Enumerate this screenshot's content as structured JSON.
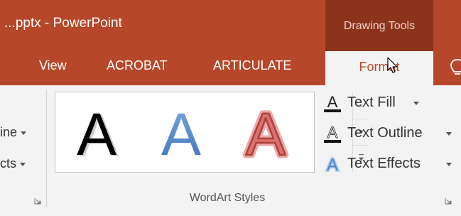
{
  "window": {
    "title": "...pptx - PowerPoint",
    "contextual_group": "Drawing Tools"
  },
  "tabs": {
    "view": "View",
    "acrobat": "ACROBAT",
    "articulate": "ARTICULATE",
    "format": "Format",
    "active": "Format"
  },
  "ribbon": {
    "left_clipped": {
      "shape_outline": "ine",
      "shape_effects": "cts"
    },
    "wordart_gallery": {
      "items": [
        {
          "glyph": "A",
          "style": "black fill with shadow",
          "fill": "#000000"
        },
        {
          "glyph": "A",
          "style": "blue gradient fill",
          "fill": "#5a8ccf"
        },
        {
          "glyph": "A",
          "style": "red outline with glow",
          "fill": "#d9716e"
        }
      ]
    },
    "commands": {
      "text_fill": "Text Fill",
      "text_outline": "Text Outline",
      "text_effects": "Text Effects"
    },
    "group_label": "WordArt Styles"
  },
  "icons": {
    "text_fill": "text-fill-icon",
    "text_outline": "text-outline-icon",
    "text_effects": "text-effects-icon",
    "cursor": "mouse-pointer-icon",
    "launcher": "dialog-launcher-icon"
  },
  "colors": {
    "accent": "#b7472a",
    "contextual_band": "#8d331c",
    "active_tab_text": "#c0492b",
    "ribbon_bg": "#f3f3f3"
  }
}
